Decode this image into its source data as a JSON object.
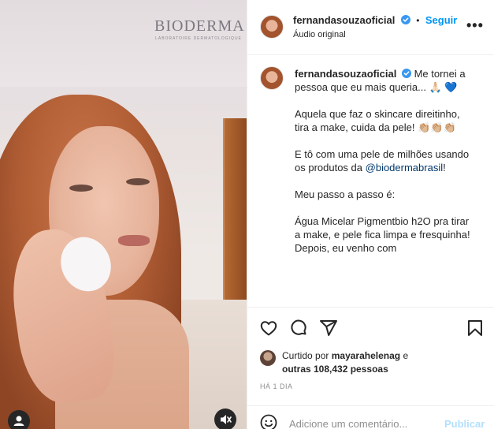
{
  "media": {
    "brand_name": "BIODERMA",
    "brand_sub": "LABORATOIRE DERMATOLOGIQUE"
  },
  "header": {
    "username": "fernandasouzaoficial",
    "separator": "•",
    "follow_label": "Seguir",
    "audio_label": "Áudio original",
    "more_label": "•••"
  },
  "caption": {
    "username": "fernandasouzaoficial",
    "line1": "Me tornei a pessoa que eu mais queria...",
    "line1_emoji": "🙏🏻",
    "line1_heart": "💙",
    "para2": "Aquela que faz o skincare direitinho, tira a make, cuida da pele!",
    "para2_emoji": "👏🏼👏🏼👏🏼",
    "para3_a": "E tô com uma pele de milhões usando os produtos da",
    "para3_link": "@biodermabrasil",
    "para3_end": "!",
    "para4": "Meu passo a passo é:",
    "para5": "Água Micelar Pigmentbio h2O pra tirar a make, e pele fica limpa e fresquinha!",
    "para6": "Depois, eu venho com"
  },
  "likes": {
    "prefix": "Curtido por",
    "user": "mayarahelenag",
    "conj": "e",
    "others": "outras 108,432 pessoas"
  },
  "time_label": "HÁ 1 DIA",
  "comment": {
    "placeholder": "Adicione um comentário...",
    "publish_label": "Publicar"
  },
  "colors": {
    "accent": "#0095f6",
    "verified": "#3897f0",
    "publish_disabled": "#b2dffc"
  }
}
